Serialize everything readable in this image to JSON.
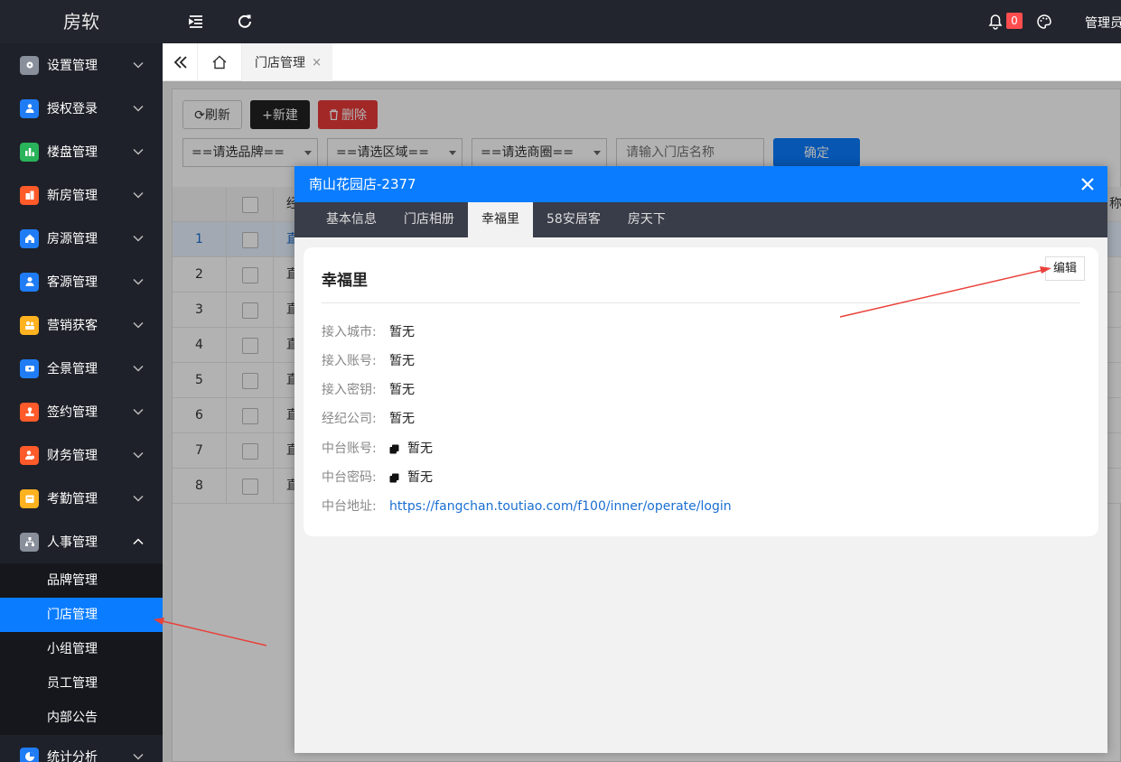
{
  "app": {
    "logo": "房软"
  },
  "sidebar": {
    "menus": [
      {
        "label": "设置管理",
        "icon": "gear-icon",
        "color": "#8a8f9c"
      },
      {
        "label": "授权登录",
        "icon": "users-icon",
        "color": "#1f7cf5"
      },
      {
        "label": "楼盘管理",
        "icon": "bar-chart-icon",
        "color": "#29b35a"
      },
      {
        "label": "新房管理",
        "icon": "building-icon",
        "color": "#ff5a2a"
      },
      {
        "label": "房源管理",
        "icon": "home-icon",
        "color": "#1f7cf5"
      },
      {
        "label": "客源管理",
        "icon": "user-icon",
        "color": "#1f7cf5"
      },
      {
        "label": "营销获客",
        "icon": "people-icon",
        "color": "#ffb220"
      },
      {
        "label": "全景管理",
        "icon": "panorama-icon",
        "color": "#1f7cf5"
      },
      {
        "label": "签约管理",
        "icon": "stamp-icon",
        "color": "#ff5a2a"
      },
      {
        "label": "财务管理",
        "icon": "finance-user-icon",
        "color": "#ff5a2a"
      },
      {
        "label": "考勤管理",
        "icon": "calendar-icon",
        "color": "#ffb220"
      },
      {
        "label": "人事管理",
        "icon": "org-icon",
        "color": "#8a8f9c"
      }
    ],
    "submenu": [
      "品牌管理",
      "门店管理",
      "小组管理",
      "员工管理",
      "内部公告"
    ],
    "active_sub": "门店管理",
    "last_menu": {
      "label": "统计分析",
      "icon": "pie-chart-icon",
      "color": "#1f7cf5"
    }
  },
  "topbar": {
    "notif_count": "0",
    "admin": "管理员"
  },
  "tabs": {
    "current": "门店管理",
    "close": "×"
  },
  "toolbar": {
    "refresh": "⟳刷新",
    "new": "+新建",
    "delete": "删除",
    "brand_select": "==请选品牌==",
    "area_select": "==请选区域==",
    "circle_select": "==请选商圈==",
    "search_placeholder": "请输入门店名称",
    "confirm": "确定"
  },
  "table": {
    "header_text": "经",
    "header_right": "称",
    "rows": [
      {
        "num": "1",
        "text": "直"
      },
      {
        "num": "2",
        "text": "直"
      },
      {
        "num": "3",
        "text": "直"
      },
      {
        "num": "4",
        "text": "直"
      },
      {
        "num": "5",
        "text": "直"
      },
      {
        "num": "6",
        "text": "直"
      },
      {
        "num": "7",
        "text": "直"
      },
      {
        "num": "8",
        "text": "直"
      }
    ]
  },
  "modal": {
    "title": "南山花园店-2377",
    "close": "✕",
    "tabs": [
      "基本信息",
      "门店相册",
      "幸福里",
      "58安居客",
      "房天下"
    ],
    "active_tab": "幸福里",
    "card": {
      "title": "幸福里",
      "edit": "编辑",
      "fields": [
        {
          "label": "接入城市:",
          "value": "暂无"
        },
        {
          "label": "接入账号:",
          "value": "暂无"
        },
        {
          "label": "接入密钥:",
          "value": "暂无"
        },
        {
          "label": "经纪公司:",
          "value": "暂无"
        },
        {
          "label": "中台账号:",
          "value": "暂无",
          "copy": true
        },
        {
          "label": "中台密码:",
          "value": "暂无",
          "copy": true
        },
        {
          "label": "中台地址:",
          "value": "https://fangchan.toutiao.com/f100/inner/operate/login",
          "link": true
        }
      ]
    }
  },
  "colors": {
    "primary": "#0a7cff",
    "danger": "#e83a3a",
    "sidebar_bg": "#1e2129",
    "arrow": "#e8413a"
  }
}
